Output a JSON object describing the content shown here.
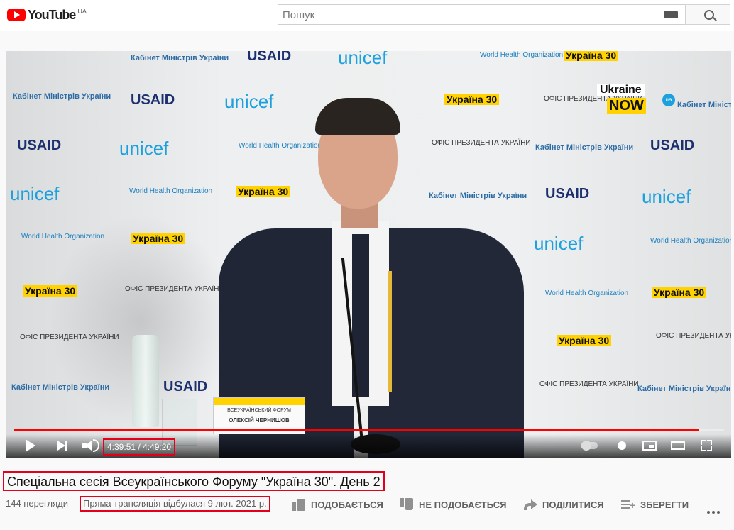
{
  "header": {
    "logo_text": "YouTube",
    "country_code": "UA",
    "search_placeholder": "Пошук"
  },
  "player": {
    "current_time": "4:39:51",
    "duration": "4:49:20",
    "time_display": "4:39:51 / 4:49:20",
    "progress_fraction": 0.965,
    "nameplate_org": "ВСЕУКРАЇНСЬКИЙ ФОРУМ",
    "nameplate_name": "ОЛЕКСІЙ ЧЕРНИШОВ",
    "backdrop": {
      "usaid": "USAID",
      "unicef": "unicef",
      "who": "World Health Organization",
      "ukraina30": "Україна 30",
      "kabinet": "Кабінет Міністрів України",
      "ofis": "ОФІС ПРЕЗИДЕНТА УКРАЇНИ",
      "ukraine_now_1": "Ukraine",
      "ukraine_now_2": "NOW",
      "ukraine_now_badge": "ua"
    }
  },
  "video": {
    "title": "Спеціальна сесія Всеукраїнського Форуму \"Україна 30\". День 2",
    "views": "144 перегляди",
    "date": "Пряма трансляція відбулася 9 лют. 2021 р."
  },
  "actions": {
    "like": "ПОДОБАЄТЬСЯ",
    "dislike": "НЕ ПОДОБАЄТЬСЯ",
    "share": "ПОДІЛИТИСЯ",
    "save": "ЗБЕРЕГТИ"
  },
  "colors": {
    "accent": "#ff0000",
    "highlight_box": "#e3001b"
  }
}
